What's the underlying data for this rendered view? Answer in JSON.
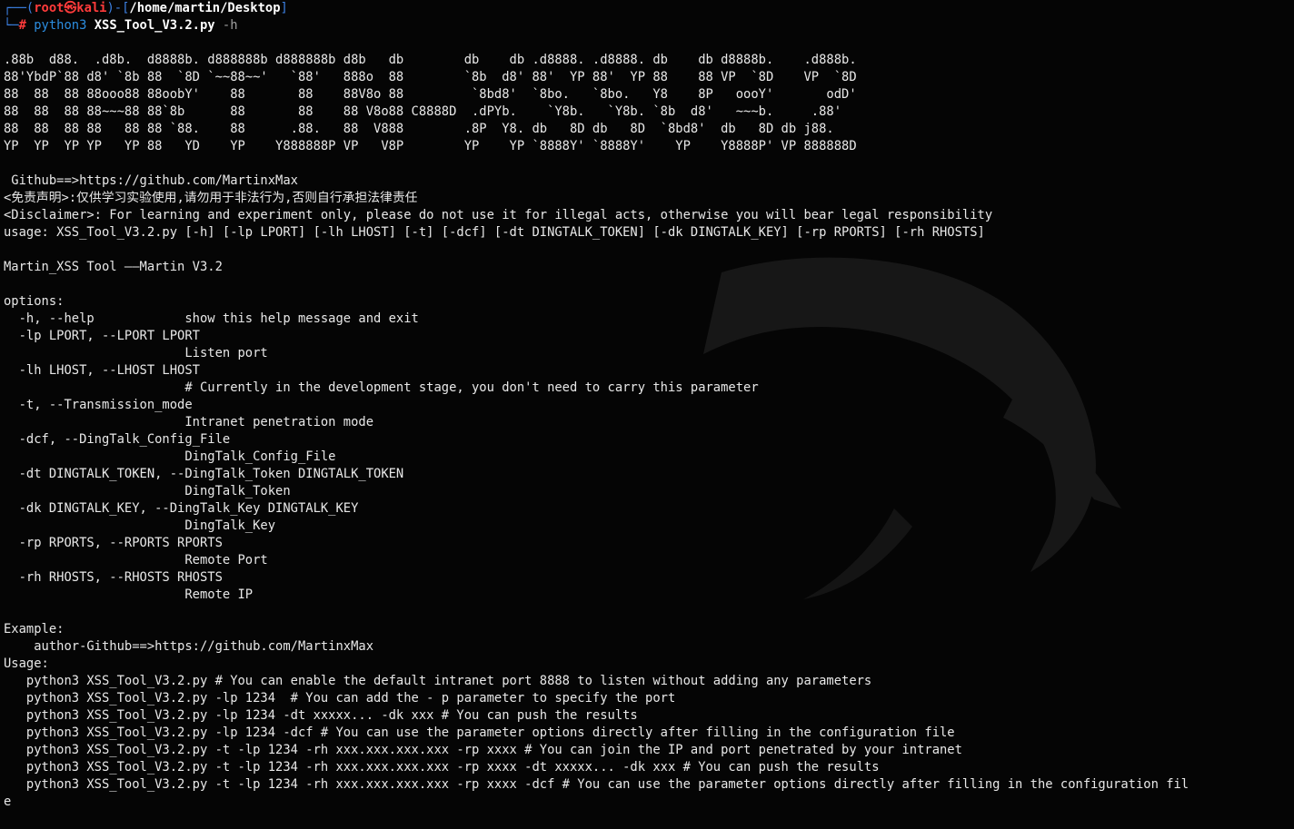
{
  "prompt": {
    "box_top": "┌──(",
    "user_host": "root㉿kali",
    "box_mid": ")-[",
    "cwd": "/home/martin/Desktop",
    "box_end": "]",
    "box_bottom": "└─",
    "hash": "# ",
    "command": "python3 ",
    "script": "XSS_Tool_V3.2.py",
    "flag": " -h"
  },
  "banner": [
    ".88b  d88.  .d8b.  d8888b. d888888b d888888b d8b   db        db    db .d8888. .d8888. db    db d8888b.    .d888b.",
    "88'YbdP`88 d8' `8b 88  `8D `~~88~~'   `88'   888o  88        `8b  d8' 88'  YP 88'  YP 88    88 VP  `8D    VP  `8D",
    "88  88  88 88ooo88 88oobY'    88       88    88V8o 88         `8bd8'  `8bo.   `8bo.   Y8    8P   oooY'       odD'",
    "88  88  88 88~~~88 88`8b      88       88    88 V8o88 C8888D  .dPYb.    `Y8b.   `Y8b. `8b  d8'   ~~~b.     .88'",
    "88  88  88 88   88 88 `88.    88      .88.   88  V888        .8P  Y8. db   8D db   8D  `8bd8'  db   8D db j88.",
    "YP  YP  YP YP   YP 88   YD    YP    Y888888P VP   V8P        YP    YP `8888Y' `8888Y'    YP    Y8888P' VP 888888D"
  ],
  "output": [
    " Github==>https://github.com/MartinxMax",
    "<免责声明>:仅供学习实验使用,请勿用于非法行为,否则自行承担法律责任",
    "<Disclaimer>: For learning and experiment only, please do not use it for illegal acts, otherwise you will bear legal responsibility",
    "usage: XSS_Tool_V3.2.py [-h] [-lp LPORT] [-lh LHOST] [-t] [-dcf] [-dt DINGTALK_TOKEN] [-dk DINGTALK_KEY] [-rp RPORTS] [-rh RHOSTS]",
    "",
    "Martin_XSS Tool ——Martin V3.2",
    "",
    "options:",
    "  -h, --help            show this help message and exit",
    "  -lp LPORT, --LPORT LPORT",
    "                        Listen port",
    "  -lh LHOST, --LHOST LHOST",
    "                        # Currently in the development stage, you don't need to carry this parameter",
    "  -t, --Transmission_mode",
    "                        Intranet penetration mode",
    "  -dcf, --DingTalk_Config_File",
    "                        DingTalk_Config_File",
    "  -dt DINGTALK_TOKEN, --DingTalk_Token DINGTALK_TOKEN",
    "                        DingTalk_Token",
    "  -dk DINGTALK_KEY, --DingTalk_Key DINGTALK_KEY",
    "                        DingTalk_Key",
    "  -rp RPORTS, --RPORTS RPORTS",
    "                        Remote Port",
    "  -rh RHOSTS, --RHOSTS RHOSTS",
    "                        Remote IP",
    "",
    "Example:",
    "    author-Github==>https://github.com/MartinxMax",
    "Usage:",
    "   python3 XSS_Tool_V3.2.py # You can enable the default intranet port 8888 to listen without adding any parameters",
    "   python3 XSS_Tool_V3.2.py -lp 1234  # You can add the - p parameter to specify the port",
    "   python3 XSS_Tool_V3.2.py -lp 1234 -dt xxxxx... -dk xxx # You can push the results",
    "   python3 XSS_Tool_V3.2.py -lp 1234 -dcf # You can use the parameter options directly after filling in the configuration file",
    "   python3 XSS_Tool_V3.2.py -t -lp 1234 -rh xxx.xxx.xxx.xxx -rp xxxx # You can join the IP and port penetrated by your intranet",
    "   python3 XSS_Tool_V3.2.py -t -lp 1234 -rh xxx.xxx.xxx.xxx -rp xxxx -dt xxxxx... -dk xxx # You can push the results",
    "   python3 XSS_Tool_V3.2.py -t -lp 1234 -rh xxx.xxx.xxx.xxx -rp xxxx -dcf # You can use the parameter options directly after filling in the configuration fil",
    "e"
  ],
  "colors": {
    "background": "#050505",
    "text": "#e8e8e8",
    "prompt_box": "#3b7fe0",
    "user": "#ff3b3b",
    "command": "#2c8ddf"
  },
  "icons": {
    "watermark": "kali-dragon-icon"
  }
}
